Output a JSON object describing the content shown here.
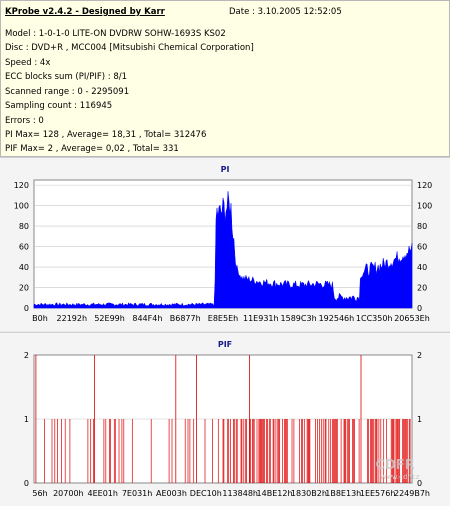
{
  "header": {
    "app_title": "KProbe v2.4.2 - Designed by Karr",
    "date": "Date : 3.10.2005 12:52:05",
    "lines": [
      "Model : 1-0-1-0 LITE-ON DVDRW SOHW-1693S KS02",
      "Disc : DVD+R , MCC004 [Mitsubishi Chemical Corporation]",
      "Speed : 4x",
      "ECC blocks sum (PI/PIF) : 8/1",
      "Scanned range : 0 - 2295091",
      "Sampling count : 116945",
      "Errors : 0",
      "PI Max= 128 , Average= 18,31 , Total= 312476",
      "PIF Max= 2 , Average= 0,02 , Total= 331"
    ]
  },
  "colors": {
    "pi": "#0000ff",
    "pif": "#e00000",
    "grid": "#c8c8c8",
    "header_bg": "#ffffe6",
    "chart_bg": "#ffffff"
  },
  "watermark": "CDFR www.cdr.cz",
  "chart_data": [
    {
      "type": "area",
      "title": "PI",
      "ylim": [
        0,
        125
      ],
      "yticks": [
        0,
        20,
        40,
        60,
        80,
        100,
        120
      ],
      "xticks": [
        "B0h",
        "22192h",
        "52E99h",
        "844F4h",
        "B6877h",
        "E8E5Eh",
        "11E931h",
        "1589C3h",
        "192546h",
        "1CC350h",
        "20653Eh"
      ],
      "profile": [
        {
          "x": 0.0,
          "y": 3
        },
        {
          "x": 0.4,
          "y": 3
        },
        {
          "x": 0.478,
          "y": 3
        },
        {
          "x": 0.482,
          "y": 88
        },
        {
          "x": 0.49,
          "y": 85
        },
        {
          "x": 0.5,
          "y": 90
        },
        {
          "x": 0.52,
          "y": 95
        },
        {
          "x": 0.535,
          "y": 38
        },
        {
          "x": 0.55,
          "y": 28
        },
        {
          "x": 0.6,
          "y": 24
        },
        {
          "x": 0.65,
          "y": 22
        },
        {
          "x": 0.7,
          "y": 21
        },
        {
          "x": 0.75,
          "y": 22
        },
        {
          "x": 0.79,
          "y": 21
        },
        {
          "x": 0.795,
          "y": 9
        },
        {
          "x": 0.86,
          "y": 9
        },
        {
          "x": 0.865,
          "y": 33
        },
        {
          "x": 0.9,
          "y": 36
        },
        {
          "x": 0.95,
          "y": 44
        },
        {
          "x": 1.0,
          "y": 55
        }
      ]
    },
    {
      "type": "bar",
      "title": "PIF",
      "ylim": [
        0,
        2
      ],
      "yticks": [
        0,
        1,
        2
      ],
      "xticks": [
        "56h",
        "20700h",
        "4EE01h",
        "7E031h",
        "AE003h",
        "DEC10h",
        "113848h",
        "14BE12h",
        "1830B2h",
        "1B8E13h",
        "1EE576h",
        "2249B7h"
      ],
      "twos": [
        0.005,
        0.16,
        0.375,
        0.43,
        0.57,
        0.865
      ],
      "ones_density": "dense in 0.47-0.85 and 0.88-1.0, sparse elsewhere"
    }
  ]
}
